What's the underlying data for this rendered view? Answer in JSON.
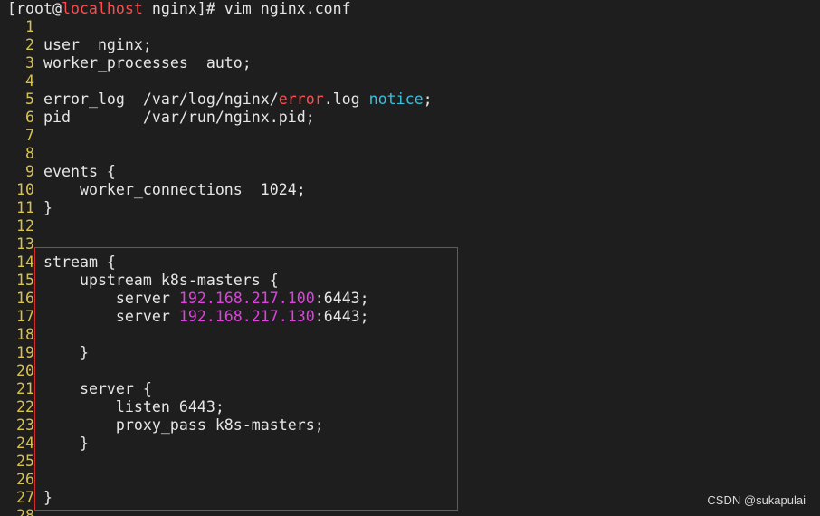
{
  "prompt": {
    "open_bracket": "[",
    "user": "root@",
    "host": "localhost",
    "rest": " nginx]# vim nginx.conf"
  },
  "lines": [
    {
      "num": "1",
      "segments": [
        {
          "text": "",
          "kind": "plain"
        }
      ]
    },
    {
      "num": "2",
      "segments": [
        {
          "text": "user  nginx;",
          "kind": "plain"
        }
      ]
    },
    {
      "num": "3",
      "segments": [
        {
          "text": "worker_processes  auto;",
          "kind": "plain"
        }
      ]
    },
    {
      "num": "4",
      "segments": [
        {
          "text": "",
          "kind": "plain"
        }
      ]
    },
    {
      "num": "5",
      "segments": [
        {
          "text": "error_log  /var/log/nginx/",
          "kind": "plain"
        },
        {
          "text": "error",
          "kind": "err"
        },
        {
          "text": ".log ",
          "kind": "plain"
        },
        {
          "text": "notice",
          "kind": "notice"
        },
        {
          "text": ";",
          "kind": "plain"
        }
      ]
    },
    {
      "num": "6",
      "segments": [
        {
          "text": "pid        /var/run/nginx.pid;",
          "kind": "plain"
        }
      ]
    },
    {
      "num": "7",
      "segments": [
        {
          "text": "",
          "kind": "plain"
        }
      ]
    },
    {
      "num": "8",
      "segments": [
        {
          "text": "",
          "kind": "plain"
        }
      ]
    },
    {
      "num": "9",
      "segments": [
        {
          "text": "events {",
          "kind": "plain"
        }
      ]
    },
    {
      "num": "10",
      "segments": [
        {
          "text": "    worker_connections  1024;",
          "kind": "plain"
        }
      ]
    },
    {
      "num": "11",
      "segments": [
        {
          "text": "}",
          "kind": "plain"
        }
      ]
    },
    {
      "num": "12",
      "segments": [
        {
          "text": "",
          "kind": "plain"
        }
      ]
    },
    {
      "num": "13",
      "segments": [
        {
          "text": "",
          "kind": "plain"
        }
      ]
    },
    {
      "num": "14",
      "segments": [
        {
          "text": "stream {",
          "kind": "plain"
        }
      ]
    },
    {
      "num": "15",
      "segments": [
        {
          "text": "    upstream k8s-masters {",
          "kind": "plain"
        }
      ]
    },
    {
      "num": "16",
      "segments": [
        {
          "text": "        server ",
          "kind": "plain"
        },
        {
          "text": "192.168.217.100",
          "kind": "ip"
        },
        {
          "text": ":6443;",
          "kind": "plain"
        }
      ]
    },
    {
      "num": "17",
      "segments": [
        {
          "text": "        server ",
          "kind": "plain"
        },
        {
          "text": "192.168.217.130",
          "kind": "ip"
        },
        {
          "text": ":6443;",
          "kind": "plain"
        }
      ]
    },
    {
      "num": "18",
      "segments": [
        {
          "text": "",
          "kind": "plain"
        }
      ]
    },
    {
      "num": "19",
      "segments": [
        {
          "text": "    }",
          "kind": "plain"
        }
      ]
    },
    {
      "num": "20",
      "segments": [
        {
          "text": "",
          "kind": "plain"
        }
      ]
    },
    {
      "num": "21",
      "segments": [
        {
          "text": "    server {",
          "kind": "plain"
        }
      ]
    },
    {
      "num": "22",
      "segments": [
        {
          "text": "        listen 6443;",
          "kind": "plain"
        }
      ]
    },
    {
      "num": "23",
      "segments": [
        {
          "text": "        proxy_pass k8s-masters;",
          "kind": "plain"
        }
      ]
    },
    {
      "num": "24",
      "segments": [
        {
          "text": "    }",
          "kind": "plain"
        }
      ]
    },
    {
      "num": "25",
      "segments": [
        {
          "text": "",
          "kind": "plain"
        }
      ]
    },
    {
      "num": "26",
      "segments": [
        {
          "text": "",
          "kind": "plain"
        }
      ]
    },
    {
      "num": "27",
      "segments": [
        {
          "text": "}",
          "kind": "plain"
        }
      ]
    },
    {
      "num": "28",
      "segments": [
        {
          "text": "",
          "kind": "plain"
        }
      ]
    }
  ],
  "watermark": "CSDN @sukapulai",
  "colors": {
    "background": "#1e1e1e",
    "text": "#e6e6e6",
    "line_number": "#d7c34a",
    "host": "#ff4d4d",
    "error_keyword": "#ff4d4d",
    "notice_keyword": "#33c1e0",
    "ip_address": "#e340e3",
    "highlight_box": "#d42a2a"
  }
}
